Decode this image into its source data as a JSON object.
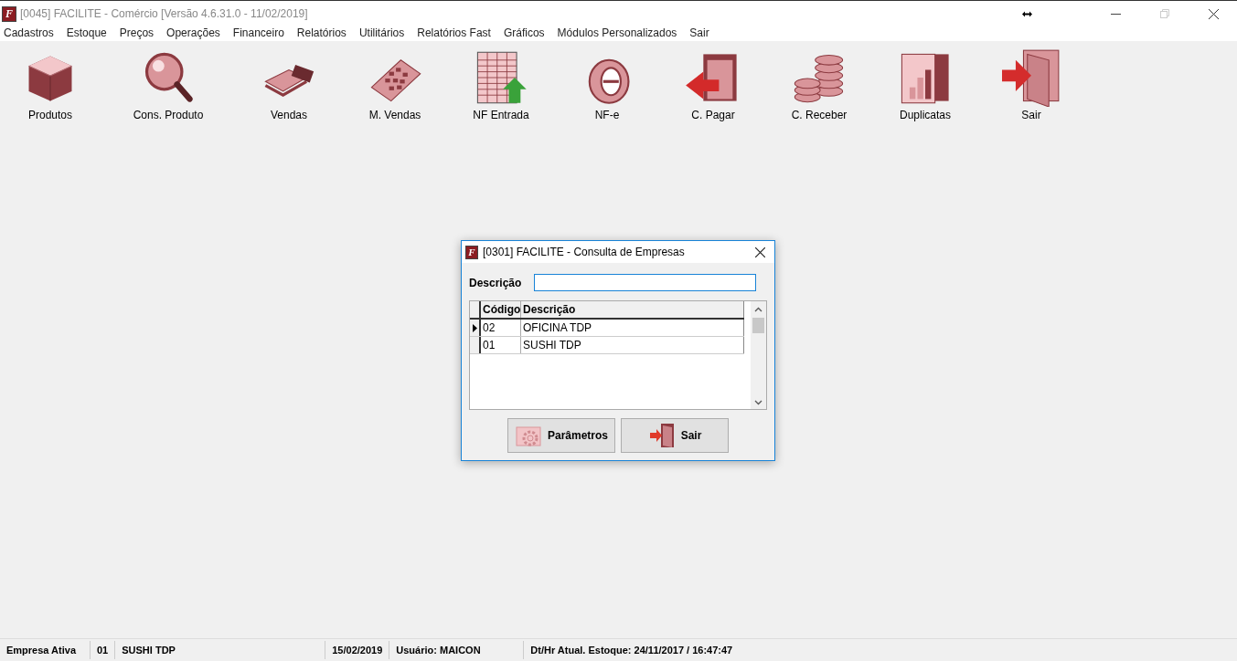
{
  "window": {
    "logo": "F",
    "title": "[0045] FACILITE - Comércio [Versão 4.6.31.0 - 11/02/2019]"
  },
  "menu": [
    "Cadastros",
    "Estoque",
    "Preços",
    "Operações",
    "Financeiro",
    "Relatórios",
    "Utilitários",
    "Relatórios Fast",
    "Gráficos",
    "Módulos Personalizados",
    "Sair"
  ],
  "toolbar": [
    {
      "label": "Produtos"
    },
    {
      "label": "Cons. Produto"
    },
    {
      "label": "Vendas"
    },
    {
      "label": "M. Vendas"
    },
    {
      "label": "NF Entrada"
    },
    {
      "label": "NF-e"
    },
    {
      "label": "C. Pagar"
    },
    {
      "label": "C. Receber"
    },
    {
      "label": "Duplicatas"
    },
    {
      "label": "Sair"
    }
  ],
  "dialog": {
    "logo": "F",
    "title": "[0301] FACILITE - Consulta de Empresas",
    "search_label": "Descrição",
    "table": {
      "columns": [
        "Código",
        "Descrição"
      ],
      "rows": [
        {
          "cells": [
            "02",
            "OFICINA TDP"
          ],
          "selected": true
        },
        {
          "cells": [
            "01",
            "SUSHI TDP"
          ],
          "selected": false
        }
      ]
    },
    "buttons": [
      "Parâmetros",
      "Sair"
    ]
  },
  "status_bar": [
    "Empresa Ativa",
    "01",
    "SUSHI TDP",
    "15/02/2019",
    "Usuário: MAICON",
    "Dt/Hr Atual. Estoque: 24/11/2017 / 16:47:47"
  ]
}
